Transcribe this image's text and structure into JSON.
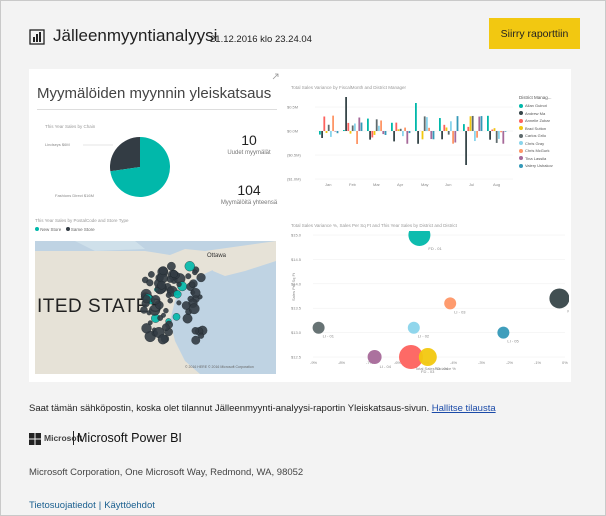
{
  "header": {
    "title": "Jälleenmyyntianalyysi",
    "timestamp": "21.12.2016 klo 23.24.04",
    "go_button": "Siirry raporttiin"
  },
  "snapshot": {
    "overview_title": "Myymälöiden myynnin yleiskatsaus",
    "pie": {
      "title": "This Year Sales by Chain",
      "slices": [
        {
          "label": "Lindseys $6M",
          "value": 6,
          "color": "#333c44"
        },
        {
          "label": "Fashions Direct $16M",
          "value": 16,
          "color": "#01b8aa"
        }
      ]
    },
    "kpis": [
      {
        "value": "10",
        "label": "Uudet myymälät"
      },
      {
        "value": "104",
        "label": "Myymälöitä yhteensä"
      }
    ],
    "map": {
      "title": "This Year Sales by PostalCode and Store Type",
      "legend": [
        {
          "label": "New Store",
          "color": "#01b8aa"
        },
        {
          "label": "Same Store",
          "color": "#333c44"
        }
      ],
      "country_label": "ITED STATES",
      "city_label": "Ottawa",
      "credit": "© 2016 HERE  © 2016 Microsoft Corporation"
    },
    "bar_chart": {
      "title": "Total Sales Variance by FiscalMonth and District Manager",
      "y_ticks": [
        "$0.5M",
        "$0.0M",
        "($0.5M)",
        "($1.0M)"
      ],
      "x_ticks": [
        "Jan",
        "Feb",
        "Mar",
        "Apr",
        "May",
        "Jun",
        "Jul",
        "Aug"
      ],
      "legend_title": "District Manag...",
      "legend": [
        {
          "label": "Allan Guinot",
          "color": "#01b8aa"
        },
        {
          "label": "Andrew Ma",
          "color": "#374649"
        },
        {
          "label": "Annelie Zubar",
          "color": "#fd625e"
        },
        {
          "label": "Brad Sutton",
          "color": "#f2c80f"
        },
        {
          "label": "Carlos Grilo",
          "color": "#5f6b6d"
        },
        {
          "label": "Chris Gray",
          "color": "#8ad4eb"
        },
        {
          "label": "Chris McGurk",
          "color": "#fe9666"
        },
        {
          "label": "Tina Lassila",
          "color": "#a66999"
        },
        {
          "label": "Valery Ushakov",
          "color": "#3599b8"
        }
      ]
    },
    "bubble_chart": {
      "title": "Total Sales Variance %, Sales Per Sq Ft and This Year Sales by District and District",
      "y_ticks": [
        "$15.0",
        "$14.5",
        "$14.0",
        "$13.5",
        "$13.0",
        "$12.5"
      ],
      "x_ticks": [
        "-9%",
        "-8%",
        "-7%",
        "-6%",
        "-5%",
        "-4%",
        "-3%",
        "-2%",
        "-1%",
        "0%"
      ],
      "y_label": "Sales Per Sq Ft",
      "x_label": "Total Sales Variance %",
      "bubbles": [
        {
          "label": "FD - 01",
          "color": "#01b8aa"
        },
        {
          "label": "FD - 02",
          "color": "#374649"
        },
        {
          "label": "FD - 03",
          "color": "#fd625e"
        },
        {
          "label": "FD - 04",
          "color": "#f2c80f"
        },
        {
          "label": "LI - 01",
          "color": "#5f6b6d"
        },
        {
          "label": "LI - 02",
          "color": "#8ad4eb"
        },
        {
          "label": "LI - 03",
          "color": "#fe9666"
        },
        {
          "label": "LI - 04",
          "color": "#a66999"
        },
        {
          "label": "LI - 05",
          "color": "#3599b8"
        }
      ]
    }
  },
  "footer": {
    "notice": "Saat tämän sähköpostin, koska olet tilannut Jälleenmyynti-analyysi-raportin Yleiskatsaus-sivun.",
    "manage_link": "Hallitse tilausta",
    "ms_word": "Microsoft",
    "product": "Microsoft Power BI",
    "address": "Microsoft Corporation, One Microsoft Way, Redmond, WA, 98052",
    "privacy_link": "Tietosuojatiedot",
    "separator": "|",
    "terms_link": "Käyttöehdot"
  },
  "colors": {
    "accent": "#f2c811",
    "link": "#1a4aa8",
    "background": "#f3f3f3"
  }
}
